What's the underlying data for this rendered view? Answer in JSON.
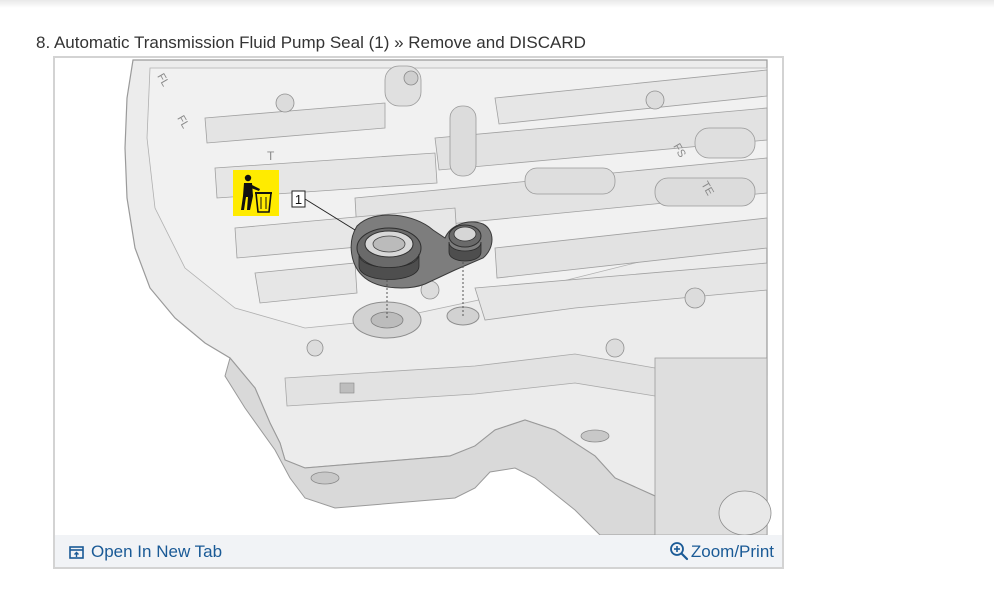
{
  "step": {
    "title": "8. Automatic Transmission Fluid Pump Seal (1) » Remove and DISCARD"
  },
  "figure": {
    "callout_number": "1",
    "discard_symbol": "trash-discard-icon",
    "embossed_letters": [
      "FL",
      "FL",
      "T",
      "FS",
      "TE"
    ],
    "toolbar": {
      "open_new_tab_label": "Open In New Tab",
      "open_new_tab_icon": "open-new-tab-icon",
      "zoom_print_label": "Zoom/Print",
      "zoom_print_icon": "zoom-magnifier-icon"
    }
  },
  "colors": {
    "title_text": "#333333",
    "link": "#1a5a96",
    "toolbar_bg": "#f1f3f6",
    "frame_border": "#d3d3d3",
    "discard_badge": "#ffeb00"
  }
}
